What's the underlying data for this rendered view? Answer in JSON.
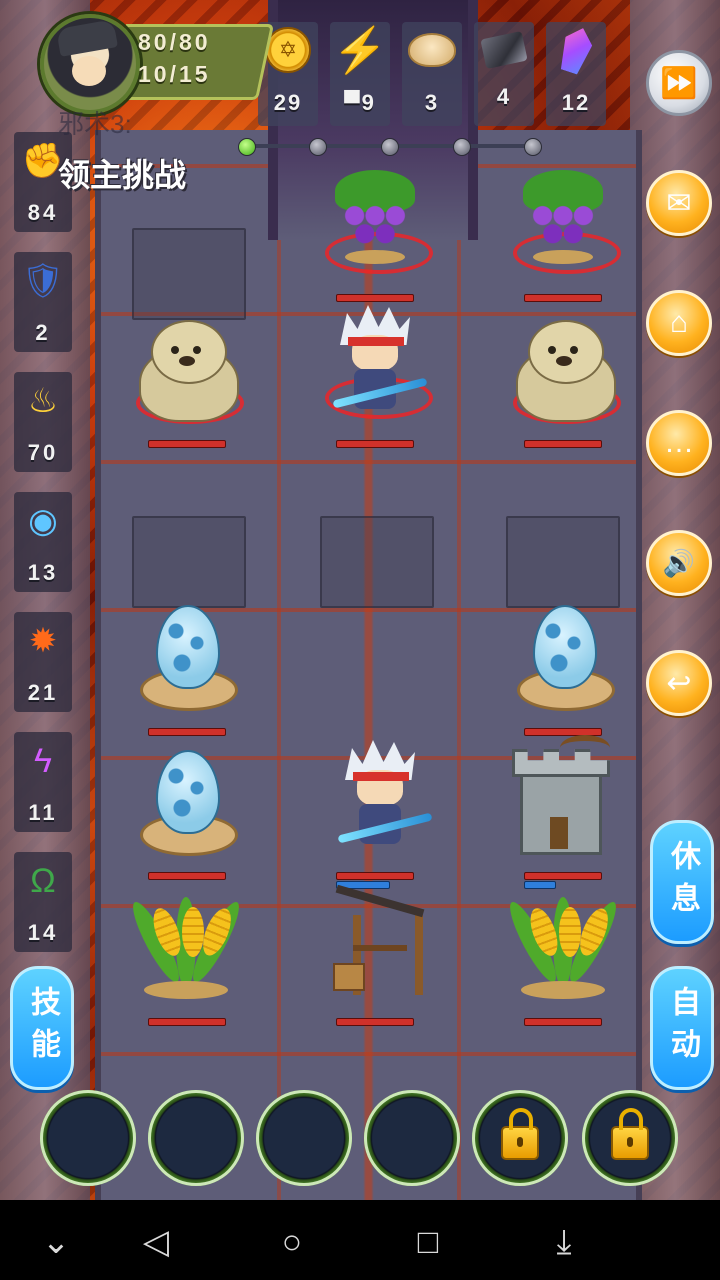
{
  "hud": {
    "hp": "80/80",
    "ap": "10/15"
  },
  "resources": [
    {
      "name": "coin",
      "icon": "coin-icon",
      "value": "29"
    },
    {
      "name": "energy",
      "icon": "lightning-icon",
      "value": "▀9"
    },
    {
      "name": "bun",
      "icon": "bun-icon",
      "value": "3"
    },
    {
      "name": "ore",
      "icon": "ore-icon",
      "value": "4"
    },
    {
      "name": "crystal",
      "icon": "crystal-icon",
      "value": "12"
    }
  ],
  "level": {
    "ghost_text": "邪术3:",
    "name": "领主挑战",
    "progress": {
      "total": 5,
      "current": 1
    }
  },
  "left_stats": [
    {
      "icon": "fist-icon",
      "value": "84"
    },
    {
      "icon": "shield-icon",
      "value": "2"
    },
    {
      "icon": "flame-spirit-icon",
      "value": "70"
    },
    {
      "icon": "wind-orb-icon",
      "value": "13"
    },
    {
      "icon": "fire-burst-icon",
      "value": "21"
    },
    {
      "icon": "lightning-strike-icon",
      "value": "11"
    },
    {
      "icon": "horseshoe-icon",
      "value": "14"
    }
  ],
  "right_menu": [
    {
      "name": "fast-forward",
      "icon": "fast-forward-icon",
      "glyph": "⏩"
    },
    {
      "name": "mail",
      "icon": "mail-icon",
      "glyph": "✉"
    },
    {
      "name": "home",
      "icon": "home-icon",
      "glyph": "⌂"
    },
    {
      "name": "chat",
      "icon": "chat-icon",
      "glyph": "…"
    },
    {
      "name": "sound",
      "icon": "speaker-icon",
      "glyph": "🔊"
    },
    {
      "name": "back",
      "icon": "return-icon",
      "glyph": "↩"
    }
  ],
  "side_buttons": {
    "rest": "休息",
    "skill": "技能",
    "auto": "自动"
  },
  "skill_slots": [
    {
      "locked": false
    },
    {
      "locked": false
    },
    {
      "locked": false
    },
    {
      "locked": false
    },
    {
      "locked": true
    },
    {
      "locked": true
    }
  ],
  "colors": {
    "accent_orange": "#ffb21f",
    "accent_blue": "#1c9cff",
    "hp_red": "#d0312a",
    "lava": "#c4340c"
  }
}
